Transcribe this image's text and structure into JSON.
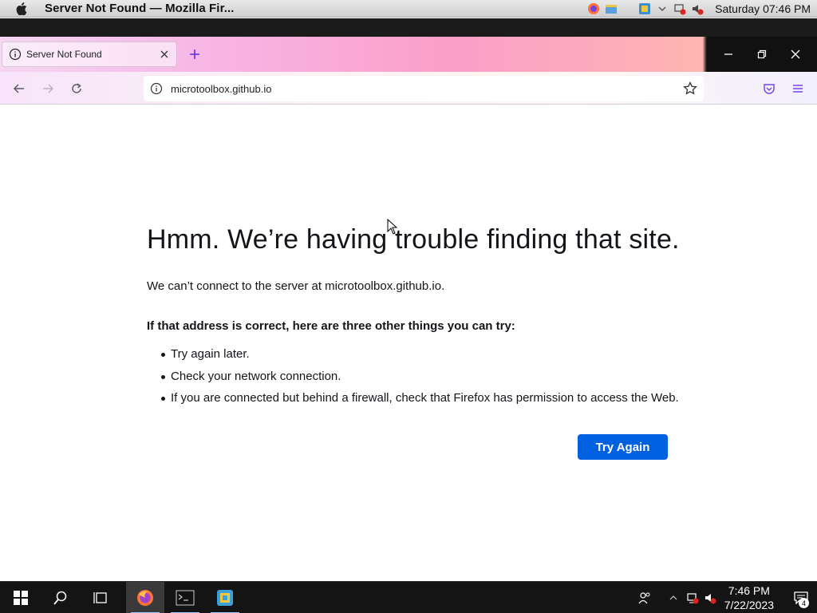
{
  "mac_menubar": {
    "title": "Server Not Found — Mozilla Fir...",
    "clock": "Saturday 07:46 PM",
    "icons": [
      "apple-icon",
      "firefox-icon",
      "folder-icon",
      "vm-icon",
      "chevron-down-icon",
      "network-error-icon",
      "volume-muted-icon"
    ]
  },
  "tab": {
    "label": "Server Not Found",
    "icons": [
      "info-icon",
      "close-icon"
    ]
  },
  "toolbar": {
    "url": "microtoolbox.github.io",
    "icons": [
      "back-icon",
      "forward-icon",
      "reload-icon",
      "info-icon",
      "star-icon",
      "pocket-icon",
      "menu-icon"
    ]
  },
  "error_page": {
    "title": "Hmm. We’re having trouble finding that site.",
    "description": "We can’t connect to the server at microtoolbox.github.io.",
    "subheading": "If that address is correct, here are three other things you can try:",
    "suggestions": [
      "Try again later.",
      "Check your network connection.",
      "If you are connected but behind a firewall, check that Firefox has permission to access the Web."
    ],
    "button_label": "Try Again"
  },
  "taskbar": {
    "time": "7:46 PM",
    "date": "7/22/2023",
    "notification_count": "4",
    "icons": [
      "windows-start-icon",
      "search-icon",
      "task-view-icon",
      "firefox-icon",
      "terminal-icon",
      "vm-icon",
      "people-icon",
      "network-error-icon",
      "volume-muted-icon",
      "notification-icon"
    ]
  },
  "colors": {
    "primary_button": "#0061e0",
    "text": "#15141a",
    "taskbar": "#141414"
  }
}
